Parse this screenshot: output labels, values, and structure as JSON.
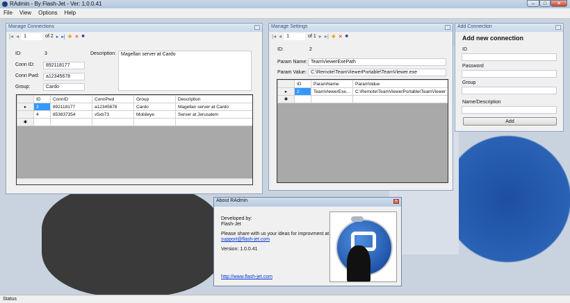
{
  "app": {
    "title": "RAdmin - By Flash-Jet - Ver: 1.0.0.41",
    "status": "Status"
  },
  "menu": [
    "File",
    "View",
    "Options",
    "Help"
  ],
  "connections": {
    "title": "Manage Connections",
    "page": "1",
    "of": "of 2",
    "labels": {
      "id": "ID:",
      "conn_id": "Conn ID:",
      "conn_pwd": "Conn Pwd:",
      "group": "Group:",
      "description": "Description:"
    },
    "values": {
      "id": "3",
      "conn_id": "892118177",
      "conn_pwd": "a12345678",
      "group": "Cardo",
      "description": "Magellan server at Cardo"
    },
    "columns": [
      "ID",
      "ConnID",
      "ConnPwd",
      "Group",
      "Description"
    ],
    "rows": [
      [
        "3",
        "892118177",
        "a12345678",
        "Cardo",
        "Magellan server at Cardo"
      ],
      [
        "4",
        "853837354",
        "v5xb73",
        "Mobileye",
        "Server at Jerusalem"
      ]
    ]
  },
  "settings": {
    "title": "Manage Settings",
    "page": "1",
    "of": "of 1",
    "labels": {
      "id": "ID:",
      "param_name": "Param Name:",
      "param_value": "Param Value:"
    },
    "values": {
      "id": "2",
      "param_name": "TeamViewerExePath",
      "param_value": "C:\\Remote\\TeamViewerPortable\\TeamViewer.exe"
    },
    "columns": [
      "ID",
      "ParamName",
      "ParamValue"
    ],
    "rows": [
      [
        "2",
        "TeamViewerExe...",
        "C:\\Remote\\TeamViewerPortable\\TeamViewer"
      ]
    ]
  },
  "add": {
    "title": "Add Connection",
    "heading": "Add new connection",
    "id_label": "ID",
    "password_label": "Password",
    "group_label": "Group",
    "desc_label": "Name/Description",
    "button": "Add"
  },
  "about": {
    "title": "About RAdmin",
    "developed_by": "Developed by:",
    "developer": "Flash-Jet",
    "share": "Please share with us your ideas for improvment at:",
    "email": "support@flash-jet.com",
    "version": "Version: 1.0.0.41",
    "website": "http://www.flash-jet.com"
  }
}
